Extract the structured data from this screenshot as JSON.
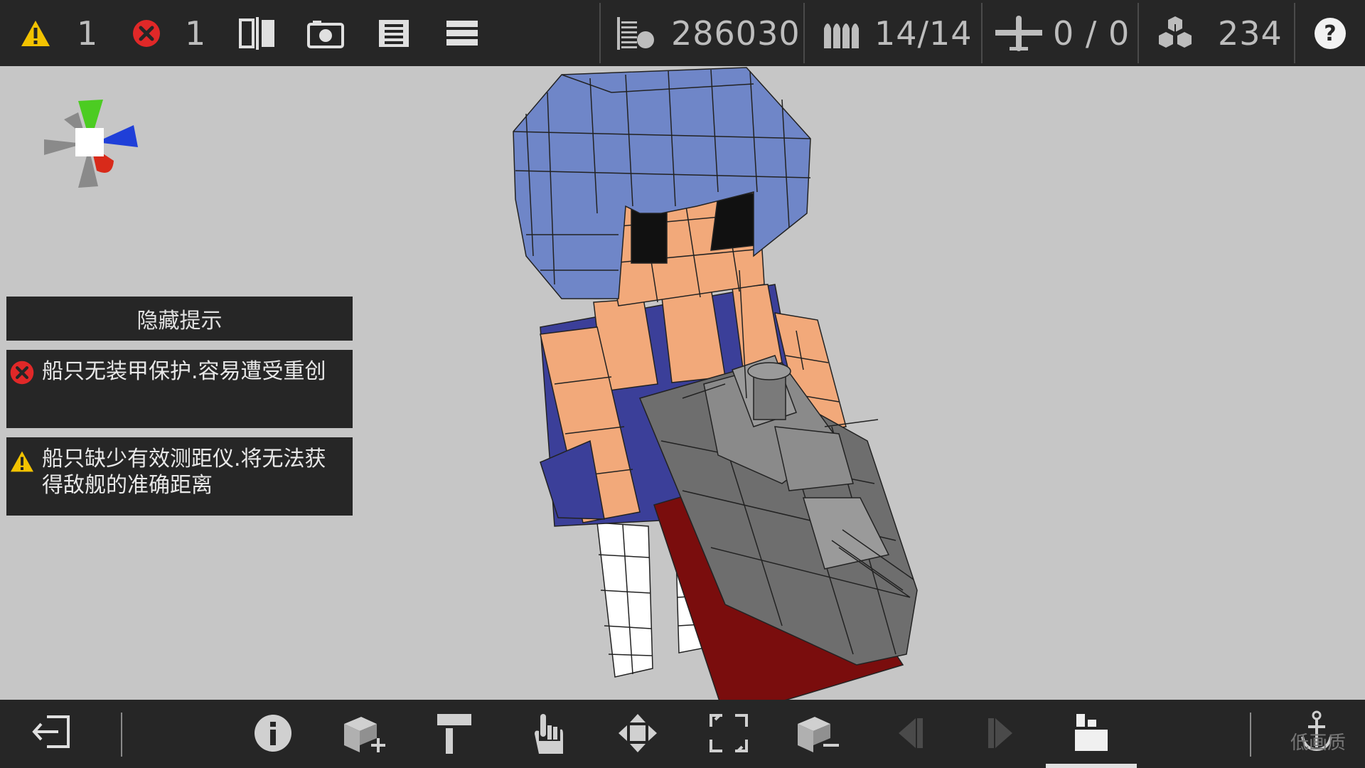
{
  "topbar": {
    "warning_count": "1",
    "error_count": "1",
    "score": "286030",
    "ammo": "14/14",
    "aircraft": "0 / 0",
    "parts": "234",
    "icons": [
      "warning-icon",
      "error-icon",
      "mirror-icon",
      "camera-icon",
      "save-icon",
      "menu-icon",
      "displacement-icon",
      "ammo-icon",
      "aircraft-icon",
      "parts-icon",
      "help-icon"
    ]
  },
  "tips_panel": {
    "hide_label": "隐藏提示",
    "error_tip": "船只无装甲保护.容易遭受重创",
    "warning_tip": "船只缺少有效测距仪.将无法获得敌舰的准确距离"
  },
  "bottombar": {
    "icons": [
      "exit-icon",
      "info-icon",
      "add-block-icon",
      "paint-icon",
      "select-hand-icon",
      "move-icon",
      "scale-icon",
      "remove-block-icon",
      "prev-icon",
      "next-icon",
      "parts-mode-icon",
      "anchor-icon"
    ]
  },
  "watermark": "低画质",
  "colors": {
    "bar_bg": "#262626",
    "viewport_bg": "#c6c6c6",
    "warning": "#f2c200",
    "error": "#e02828",
    "hair": "#6f86c8",
    "dress": "#3b3f99",
    "skin": "#f2a97a",
    "hull": "#6e6e6e"
  }
}
